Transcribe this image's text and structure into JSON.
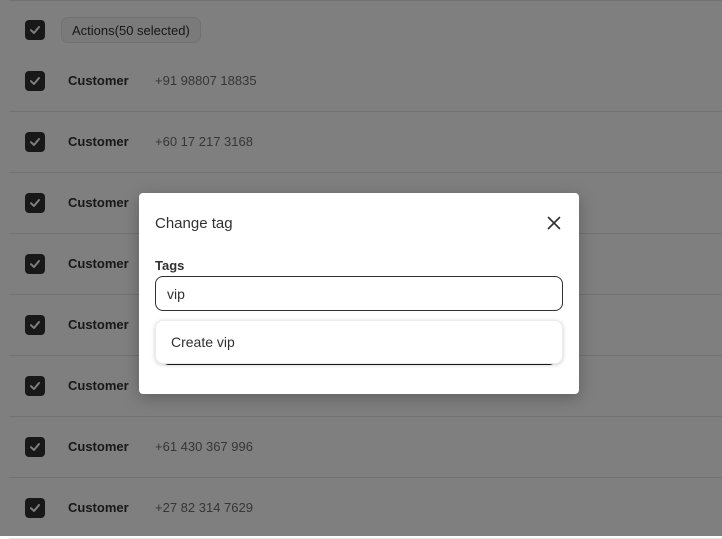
{
  "bulk_bar": {
    "actions_label": "Actions(50 selected)"
  },
  "customers": [
    {
      "name": "Customer",
      "phone": "+91 98807 18835"
    },
    {
      "name": "Customer",
      "phone": "+60 17 217 3168"
    },
    {
      "name": "Customer",
      "phone": ""
    },
    {
      "name": "Customer",
      "phone": ""
    },
    {
      "name": "Customer",
      "phone": ""
    },
    {
      "name": "Customer",
      "phone": ""
    },
    {
      "name": "Customer",
      "phone": "+61 430 367 996"
    },
    {
      "name": "Customer",
      "phone": "+27 82 314 7629"
    }
  ],
  "modal": {
    "title": "Change tag",
    "tags_label": "Tags",
    "tags_value": "vip",
    "suggestion": "Create vip"
  },
  "colors": {
    "checkbox": "#303030",
    "overlay": "rgba(0,0,0,0.5)"
  },
  "icons": {
    "checkbox": "checkmark-icon",
    "close": "close-icon"
  }
}
